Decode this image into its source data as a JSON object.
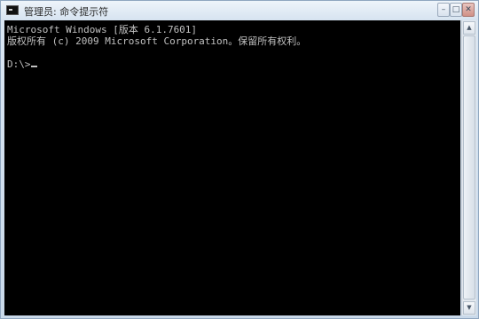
{
  "window": {
    "title": "管理员: 命令提示符"
  },
  "controls": {
    "minimize_glyph": "–",
    "maximize_glyph": "□",
    "close_glyph": "✕"
  },
  "console": {
    "lines": [
      "Microsoft Windows [版本 6.1.7601]",
      "版权所有 (c) 2009 Microsoft Corporation。保留所有权利。"
    ],
    "prompt": "D:\\>"
  },
  "scrollbar": {
    "up_glyph": "▲",
    "down_glyph": "▼",
    "position": 0
  },
  "colors": {
    "console_background": "#000000",
    "console_text": "#c0c0c0",
    "window_frame": "#c9d9ea"
  },
  "icons": {
    "app": "command-prompt-icon"
  }
}
